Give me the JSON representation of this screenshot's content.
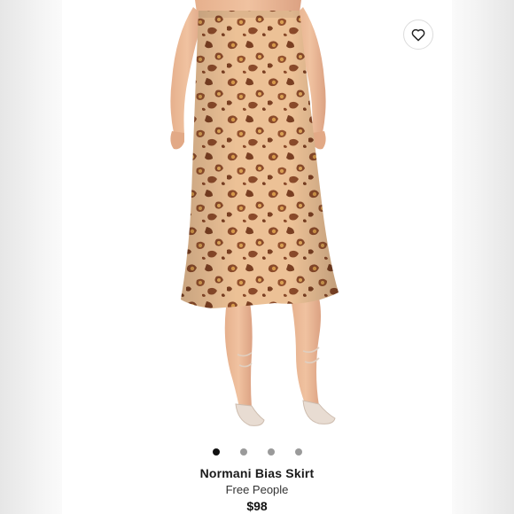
{
  "product": {
    "name": "Normani Bias Skirt",
    "brand": "Free People",
    "price": "$98"
  },
  "carousel": {
    "dot_count": 4,
    "active_index": 0
  },
  "icons": {
    "wishlist": "heart-outline-icon"
  },
  "colors": {
    "dot_active": "#111111",
    "dot_inactive": "#9a9a9a",
    "skirt_base": "#e9b98a",
    "leopard_spot": "#8a4a2a"
  }
}
